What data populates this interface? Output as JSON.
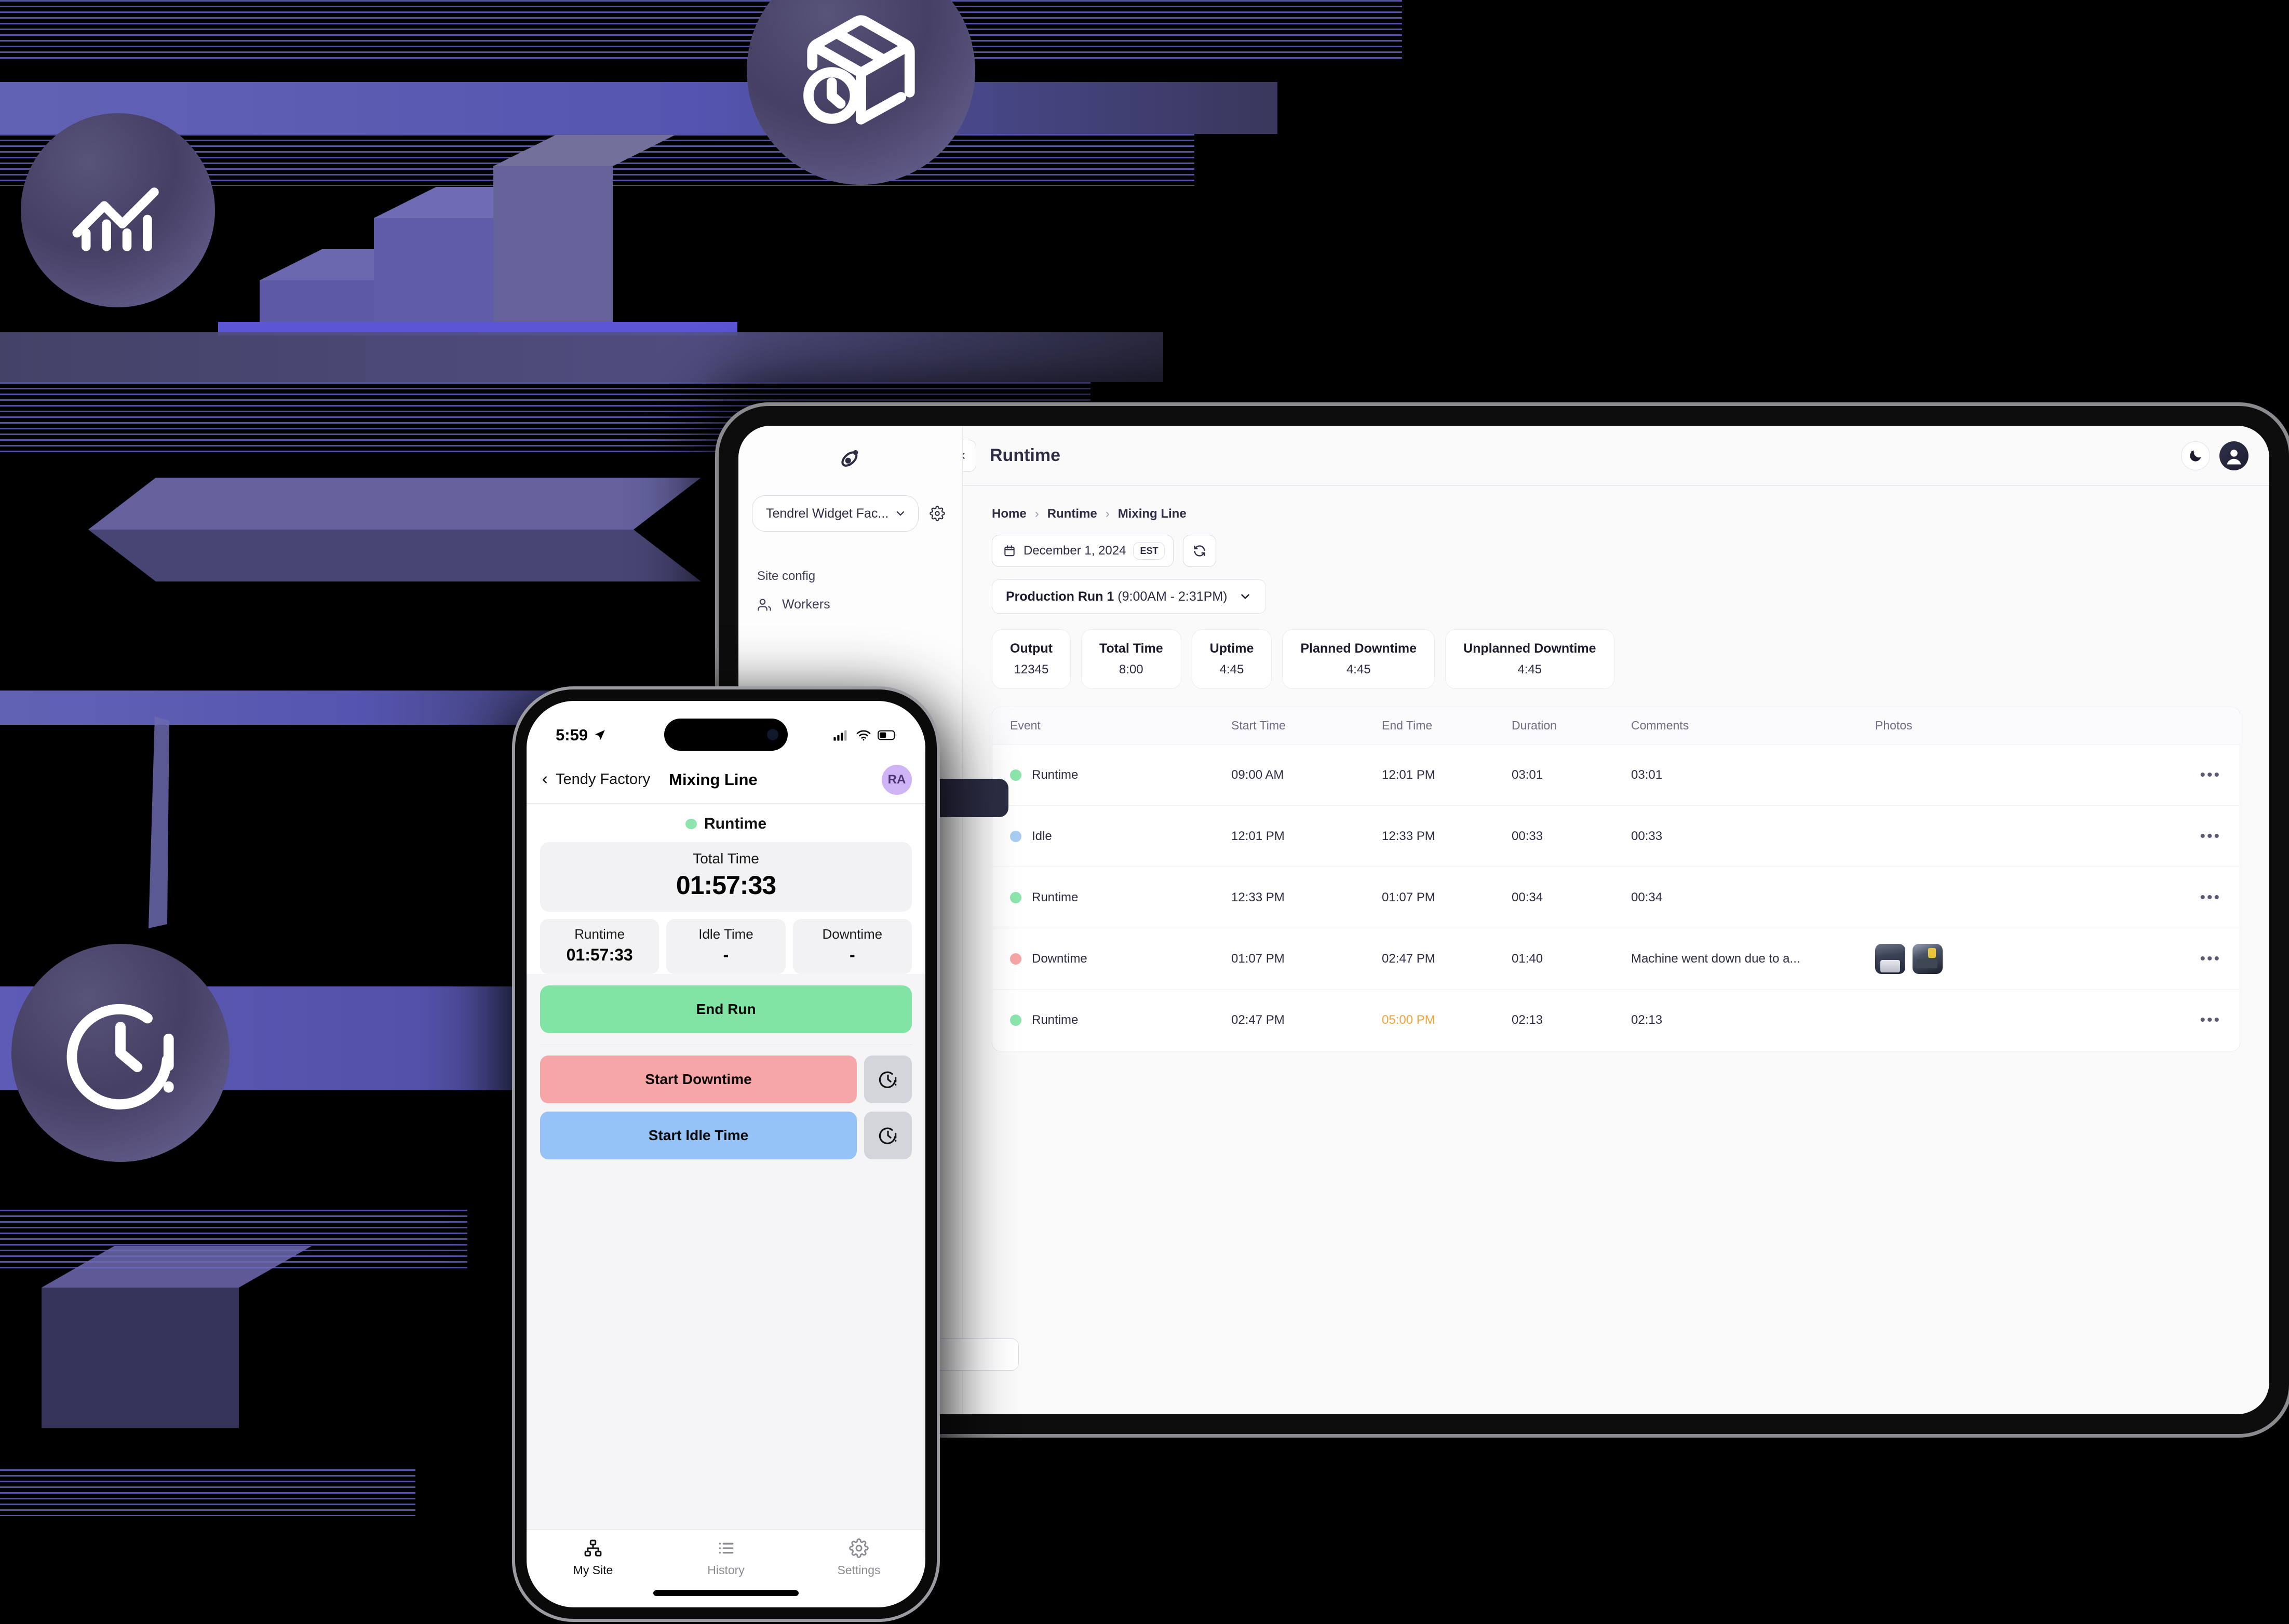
{
  "tablet": {
    "sidebar": {
      "logo_icon": "atom-logo-icon",
      "org_name": "Tendrel Widget Fac...",
      "org_chevron_icon": "chevron-down-icon",
      "settings_icon": "gear-icon",
      "section_title": "Site config",
      "items": [
        {
          "label": "Workers",
          "icon": "users-icon"
        }
      ],
      "collapse_chevron_icon": "chevron-down-icon"
    },
    "topbar": {
      "back_icon": "chevron-left-icon",
      "title": "Runtime",
      "theme_toggle_icon": "moon-icon",
      "avatar_icon": "user-avatar-icon"
    },
    "breadcrumb": {
      "items": [
        "Home",
        "Runtime",
        "Mixing Line"
      ],
      "separator": "›"
    },
    "controls": {
      "calendar_icon": "calendar-icon",
      "date": "December 1, 2024",
      "timezone": "EST",
      "refresh_icon": "refresh-icon",
      "run_label": "Production Run 1",
      "run_time_range": "(9:00AM - 2:31PM)",
      "run_chevron_icon": "chevron-down-icon"
    },
    "stats": [
      {
        "label": "Output",
        "value": "12345"
      },
      {
        "label": "Total Time",
        "value": "8:00"
      },
      {
        "label": "Uptime",
        "value": "4:45"
      },
      {
        "label": "Planned Downtime",
        "value": "4:45"
      },
      {
        "label": "Unplanned Downtime",
        "value": "4:45"
      }
    ],
    "table": {
      "columns": [
        "Event",
        "Start Time",
        "End Time",
        "Duration",
        "Comments",
        "Photos"
      ],
      "row_menu_icon": "ellipsis-icon",
      "rows": [
        {
          "event": "Runtime",
          "dot": "green",
          "start": "09:00 AM",
          "end": "12:01 PM",
          "end_warn": false,
          "duration": "03:01",
          "comment": "03:01",
          "photos": []
        },
        {
          "event": "Idle",
          "dot": "blue",
          "start": "12:01 PM",
          "end": "12:33 PM",
          "end_warn": false,
          "duration": "00:33",
          "comment": "00:33",
          "photos": []
        },
        {
          "event": "Runtime",
          "dot": "green",
          "start": "12:33 PM",
          "end": "01:07 PM",
          "end_warn": false,
          "duration": "00:34",
          "comment": "00:34",
          "photos": []
        },
        {
          "event": "Downtime",
          "dot": "red",
          "start": "01:07 PM",
          "end": "02:47 PM",
          "end_warn": false,
          "duration": "01:40",
          "comment": "Machine went down due to a...",
          "photos": [
            "machine-photo-1",
            "machine-photo-2"
          ]
        },
        {
          "event": "Runtime",
          "dot": "green",
          "start": "02:47 PM",
          "end": "05:00 PM",
          "end_warn": true,
          "duration": "02:13",
          "comment": "02:13",
          "photos": []
        }
      ]
    }
  },
  "phone": {
    "statusbar": {
      "time": "5:59",
      "location_icon": "location-arrow-icon",
      "cellular_icon": "cellular-bars-icon",
      "wifi_icon": "wifi-icon",
      "battery_icon": "battery-icon"
    },
    "navbar": {
      "back_icon": "chevron-left-icon",
      "back_label": "Tendy Factory",
      "title": "Mixing Line",
      "avatar_initials": "RA"
    },
    "status": {
      "label": "Runtime",
      "dot": "green"
    },
    "total": {
      "label": "Total Time",
      "value": "01:57:33"
    },
    "tiles": [
      {
        "label": "Runtime",
        "value": "01:57:33"
      },
      {
        "label": "Idle Time",
        "value": "-"
      },
      {
        "label": "Downtime",
        "value": "-"
      }
    ],
    "actions": {
      "end_run": "End Run",
      "start_downtime": "Start Downtime",
      "start_idle": "Start Idle Time",
      "clock_alert_icon": "clock-alert-icon"
    },
    "tabs": [
      {
        "label": "My Site",
        "icon": "sitemap-icon",
        "active": true
      },
      {
        "label": "History",
        "icon": "list-icon",
        "active": false
      },
      {
        "label": "Settings",
        "icon": "gear-icon",
        "active": false
      }
    ]
  },
  "background": {
    "badges": [
      {
        "icon": "chart-trend-icon"
      },
      {
        "icon": "box-clock-icon"
      },
      {
        "icon": "clock-alert-icon"
      }
    ]
  },
  "colors": {
    "green": "#8ce5ad",
    "blue": "#a9cdf2",
    "red": "#f6a5a5",
    "warn": "#f2a33c",
    "accent": "#6b6bc4",
    "dark": "#2c2c44"
  }
}
